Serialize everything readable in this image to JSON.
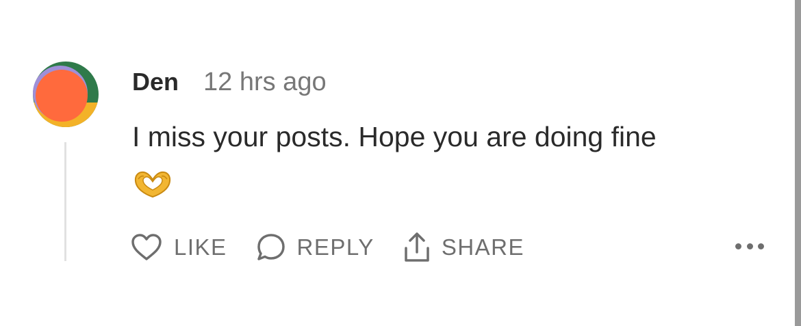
{
  "comment": {
    "author": "Den",
    "timestamp": "12 hrs ago",
    "text": "I miss your posts. Hope you are doing fine",
    "emoji": "heart-hands"
  },
  "actions": {
    "like_label": "LIKE",
    "reply_label": "REPLY",
    "share_label": "SHARE"
  },
  "icons": {
    "like": "heart-icon",
    "reply": "speech-bubble-icon",
    "share": "share-upload-icon",
    "more": "more-dots-icon"
  },
  "colors": {
    "text": "#2a2a2a",
    "muted": "#777777",
    "avatar_primary": "#ff6a3d",
    "avatar_accent_green": "#2f7a4a",
    "avatar_accent_yellow": "#f3b228",
    "avatar_accent_purple": "#9f8fd8"
  }
}
